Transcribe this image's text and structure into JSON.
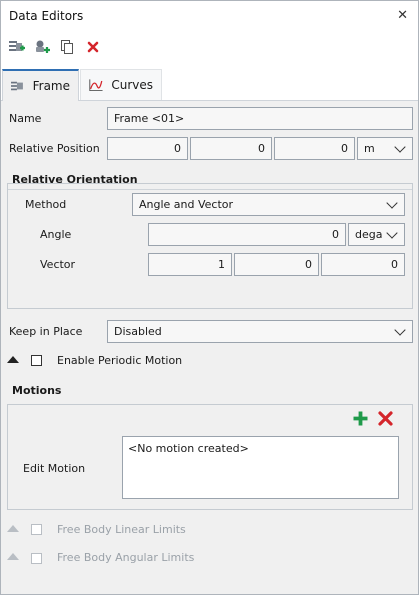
{
  "window": {
    "title": "Data Editors",
    "close": "✕"
  },
  "toolbar": {
    "items": [
      {
        "name": "add-frame",
        "icon": "add-frame-icon"
      },
      {
        "name": "add-child",
        "icon": "add-child-icon"
      },
      {
        "name": "copy",
        "icon": "copy-icon"
      },
      {
        "name": "delete",
        "icon": "delete-icon"
      }
    ]
  },
  "tabs": [
    {
      "label": "Frame",
      "icon": "frame-icon",
      "active": true
    },
    {
      "label": "Curves",
      "icon": "curves-icon",
      "active": false
    }
  ],
  "form": {
    "name_label": "Name",
    "name_value": "Frame <01>",
    "relpos_label": "Relative Position",
    "relpos_values": [
      "0",
      "0",
      "0"
    ],
    "relpos_unit": "m",
    "orientation_title": "Relative Orientation",
    "method_label": "Method",
    "method_value": "Angle and Vector",
    "angle_label": "Angle",
    "angle_value": "0",
    "angle_unit": "dega",
    "vector_label": "Vector",
    "vector_values": [
      "1",
      "0",
      "0"
    ],
    "keep_label": "Keep in Place",
    "keep_value": "Disabled",
    "periodic_label": "Enable Periodic Motion",
    "motions_title": "Motions",
    "edit_motion_label": "Edit Motion",
    "motion_list_empty": "<No motion created>",
    "fb_linear_label": "Free Body Linear Limits",
    "fb_angular_label": "Free Body Angular Limits"
  },
  "colors": {
    "accent": "#2f6fb3",
    "add_green": "#1f9a4a",
    "delete_red": "#d4252b"
  }
}
